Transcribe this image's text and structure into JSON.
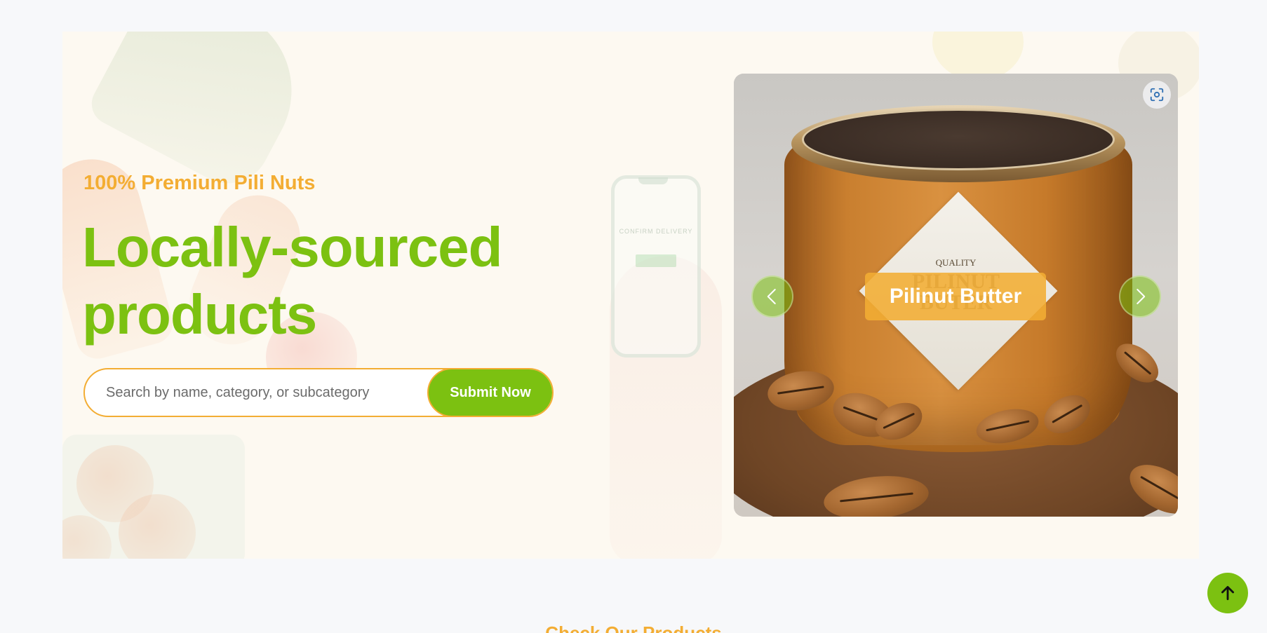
{
  "hero": {
    "eyebrow": "100% Premium Pili Nuts",
    "headline": "Locally-sourced products",
    "search": {
      "placeholder": "Search by name, category, or subcategory",
      "value": "",
      "submit_label": "Submit Now"
    },
    "background_phone_text": "CONFIRM DELIVERY"
  },
  "carousel": {
    "slide_caption": "Pilinut Butter",
    "jar_label": {
      "top": "QUALITY",
      "line1": "PILINUT",
      "line2": "BUTER"
    },
    "prev_icon": "chevron-left-icon",
    "next_icon": "chevron-right-icon",
    "zoom_icon": "focus-scan-icon"
  },
  "back_to_top_icon": "arrow-up-icon",
  "section": {
    "title": "Check Our Products"
  },
  "colors": {
    "brand_green": "#7cc111",
    "brand_orange": "#f3ad33",
    "hero_bg": "#fdf9f1",
    "page_bg": "#f7f8fa"
  }
}
